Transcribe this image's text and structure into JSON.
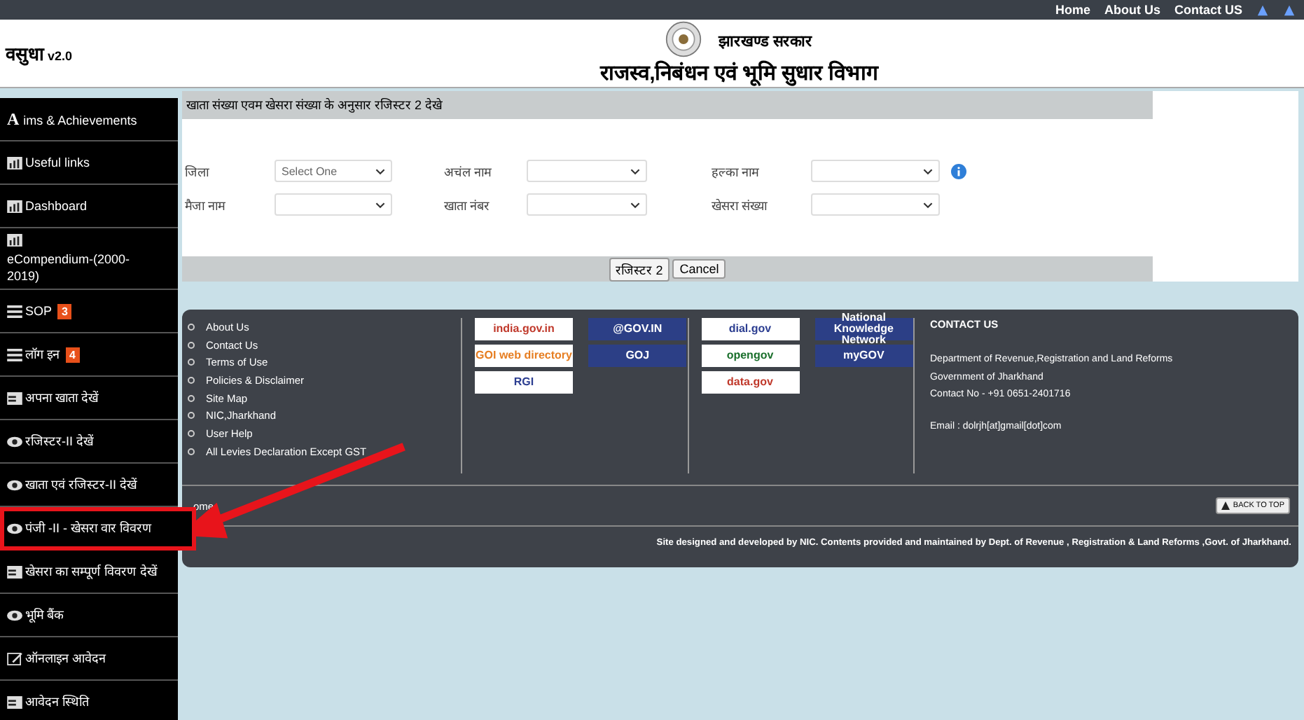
{
  "top_bar": {
    "links": [
      "Home",
      "About Us",
      "Contact US"
    ]
  },
  "header": {
    "brand": "वसुधा",
    "version": "v2.0",
    "gov": "झारखण्ड सरकार",
    "department": "राजस्व,निबंधन एवं भूमि सुधार  विभाग"
  },
  "sidebar": {
    "items": [
      {
        "kind": "letter",
        "label": "Aims & Achievements",
        "selected": false
      },
      {
        "kind": "chart",
        "label": "Useful links",
        "selected": false
      },
      {
        "kind": "chart",
        "label": "Dashboard",
        "selected": false
      },
      {
        "kind": "chart",
        "label": "eCompendium-(2000-2019)",
        "selected": false
      },
      {
        "kind": "list",
        "label": "SOP",
        "badge": "3",
        "selected": false
      },
      {
        "kind": "list",
        "label": "लॉग इन",
        "badge": "4",
        "selected": false
      },
      {
        "kind": "card",
        "label": "अपना खाता देखें",
        "selected": false
      },
      {
        "kind": "eye",
        "label": "रजिस्टर-II देखें",
        "selected": false
      },
      {
        "kind": "eye",
        "label": "खाता एवं रजिस्टर-II देखें",
        "selected": false
      },
      {
        "kind": "eye",
        "label": "पंजी -II - खेसरा वार विवरण",
        "selected": true
      },
      {
        "kind": "card",
        "label": "खेसरा का सम्पूर्ण विवरण देखें",
        "selected": false
      },
      {
        "kind": "eye",
        "label": "भूमि बैंक",
        "selected": false
      },
      {
        "kind": "edit",
        "label": "ऑनलाइन आवेदन",
        "selected": false
      },
      {
        "kind": "card",
        "label": "आवेदन स्थिति",
        "selected": false
      }
    ]
  },
  "form": {
    "title": "खाता संख्या एवम खेसरा संख्या के अनुसार रजिस्टर 2 देखे",
    "rows": [
      [
        {
          "label": "जिला",
          "value": "Select One",
          "info": false
        },
        {
          "label": "अचंल नाम",
          "info": false
        },
        {
          "label": "हल्का नाम",
          "info": true
        }
      ],
      [
        {
          "label": "मैजा नाम",
          "info": false
        },
        {
          "label": "खाता नंबर",
          "info": false
        },
        {
          "label": "खेसरा संख्या",
          "info": false
        }
      ]
    ],
    "buttons": [
      "रजिस्टर 2",
      "Cancel"
    ]
  },
  "footer": {
    "links": [
      "About Us",
      "Contact Us",
      "Terms of Use",
      "Policies & Disclaimer",
      "Site Map",
      "NIC,Jharkhand",
      "User Help",
      "All Levies Declaration Except GST"
    ],
    "logo_groups": [
      [
        "india.gov.in",
        "GOI web directory",
        "RGI"
      ],
      [
        "@GOV.IN",
        "GOJ"
      ],
      [
        "dial.gov",
        "opengov",
        "data.gov"
      ],
      [
        "National Knowledge Network",
        "myGOV"
      ]
    ],
    "contact": {
      "title": "CONTACT US",
      "lines": [
        "Department of Revenue,Registration and Land Reforms",
        "Government of Jharkhand",
        "Contact No - +91 0651-2401716"
      ],
      "email": "Email : dolrjh[at]gmail[dot]com"
    },
    "home": "ome",
    "back_to_top": "BACK TO TOP",
    "credit": "Site designed and developed by NIC. Contents provided and maintained by Dept. of Revenue , Registration & Land Reforms ,Govt. of Jharkhand."
  }
}
